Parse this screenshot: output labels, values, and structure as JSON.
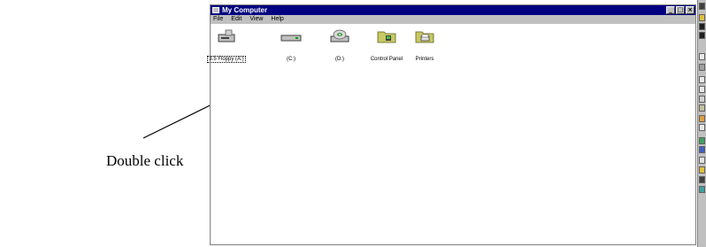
{
  "annotation": {
    "text": "Double click"
  },
  "window": {
    "title": "My Computer",
    "menu": [
      "File",
      "Edit",
      "View",
      "Help"
    ],
    "items": [
      {
        "label": "3.5 Floppy (A:)",
        "icon": "floppy-drive-icon",
        "selected": true
      },
      {
        "label": "(C:)",
        "icon": "hard-drive-icon"
      },
      {
        "label": "(D:)",
        "icon": "cd-drive-icon"
      },
      {
        "label": "Control Panel",
        "icon": "control-panel-folder-icon"
      },
      {
        "label": "Printers",
        "icon": "printers-folder-icon"
      }
    ]
  },
  "colors": {
    "titlebar": "#000080",
    "chrome": "#c0c0c0",
    "folder": "#c8c864"
  }
}
